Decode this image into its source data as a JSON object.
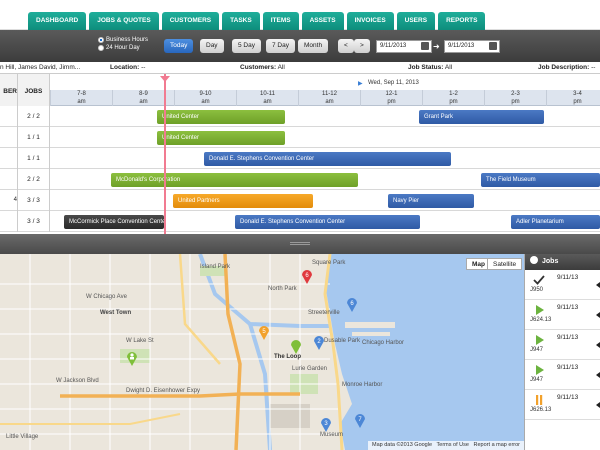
{
  "nav": {
    "tabs": [
      "DASHBOARD",
      "JOBS & QUOTES",
      "CUSTOMERS",
      "TASKS",
      "ITEMS",
      "ASSETS",
      "INVOICES",
      "USERS",
      "REPORTS"
    ]
  },
  "toolbar": {
    "radio_business": "Business Hours",
    "radio_24": "24 Hour Day",
    "btn_today": "Today",
    "btn_day": "Day",
    "btn_5day": "5 Day",
    "btn_7day": "7 Day",
    "btn_month": "Month",
    "btn_prev": "<",
    "btn_next": ">",
    "date_from": "9/11/2013",
    "date_to": "9/11/2013"
  },
  "filters": {
    "users": "n Hill, James David, Jimm...",
    "location_label": "Location:",
    "location_value": "--",
    "customers_label": "Customers:",
    "customers_value": "All",
    "status_label": "Job Status:",
    "status_value": "All",
    "desc_label": "Job Description:",
    "desc_value": "--"
  },
  "schedule": {
    "col_member": "BER",
    "col_jobs": "JOBS",
    "date_label": "Wed, Sep 11, 2013",
    "times": [
      {
        "range": "7-8",
        "ampm": "am"
      },
      {
        "range": "8-9",
        "ampm": "am"
      },
      {
        "range": "9-10",
        "ampm": "am"
      },
      {
        "range": "10-11",
        "ampm": "am"
      },
      {
        "range": "11-12",
        "ampm": "am"
      },
      {
        "range": "12-1",
        "ampm": "pm"
      },
      {
        "range": "1-2",
        "ampm": "pm"
      },
      {
        "range": "2-3",
        "ampm": "pm"
      },
      {
        "range": "3-4",
        "ampm": "pm"
      }
    ],
    "rows": [
      {
        "member": "",
        "jobs": "2 / 2"
      },
      {
        "member": "",
        "jobs": "1 / 1"
      },
      {
        "member": "",
        "jobs": "1 / 1"
      },
      {
        "member": "",
        "jobs": "2 / 2"
      },
      {
        "member": "4",
        "jobs": "3 / 3"
      },
      {
        "member": "",
        "jobs": "3 / 3"
      }
    ],
    "bars": {
      "b1": "United Center",
      "b2": "Grant Park",
      "b3": "United Center",
      "b4": "Donald E. Stephens Convention Center",
      "b5": "McDonald's Corporation",
      "b6": "The Field Museum",
      "b7": "United Partners",
      "b8": "Navy Pier",
      "b9": "McCormick Place Convention Center",
      "b10": "Donald E. Stephens Convention Center",
      "b11": "Adler Planetarium"
    }
  },
  "map": {
    "btn_map": "Map",
    "btn_satellite": "Satellite",
    "attribution": "Map data ©2013 Google",
    "terms": "Terms of Use",
    "report": "Report a map error",
    "labels": {
      "l1": "Island Park",
      "l2": "Square Park",
      "l3": "North Park",
      "l4": "Streeterville",
      "l5": "Chicago Harbor",
      "l6": "The Loop",
      "l7": "Dusable Park",
      "l8": "Lurie Garden",
      "l9": "Monroe Harbor",
      "l10": "West Town",
      "l11": "Dwight D. Eisenhower Expy",
      "l12": "W Chicago Ave",
      "l13": "W Lake St",
      "l14": "W Jackson Blvd",
      "l15": "Museum",
      "l16": "Little Village"
    },
    "pin_numbers": [
      "6",
      "6",
      "5",
      "2",
      "7",
      "3"
    ]
  },
  "jobs_panel": {
    "title": "Jobs",
    "items": [
      {
        "date": "9/11/13",
        "id": "J950",
        "icon": "check-icon"
      },
      {
        "date": "9/11/13",
        "id": "J624.13",
        "icon": "play-icon"
      },
      {
        "date": "9/11/13",
        "id": "J947",
        "icon": "play-icon"
      },
      {
        "date": "9/11/13",
        "id": "J947",
        "icon": "play-icon"
      },
      {
        "date": "9/11/13",
        "id": "J626.13",
        "icon": "pause-icon"
      }
    ]
  }
}
